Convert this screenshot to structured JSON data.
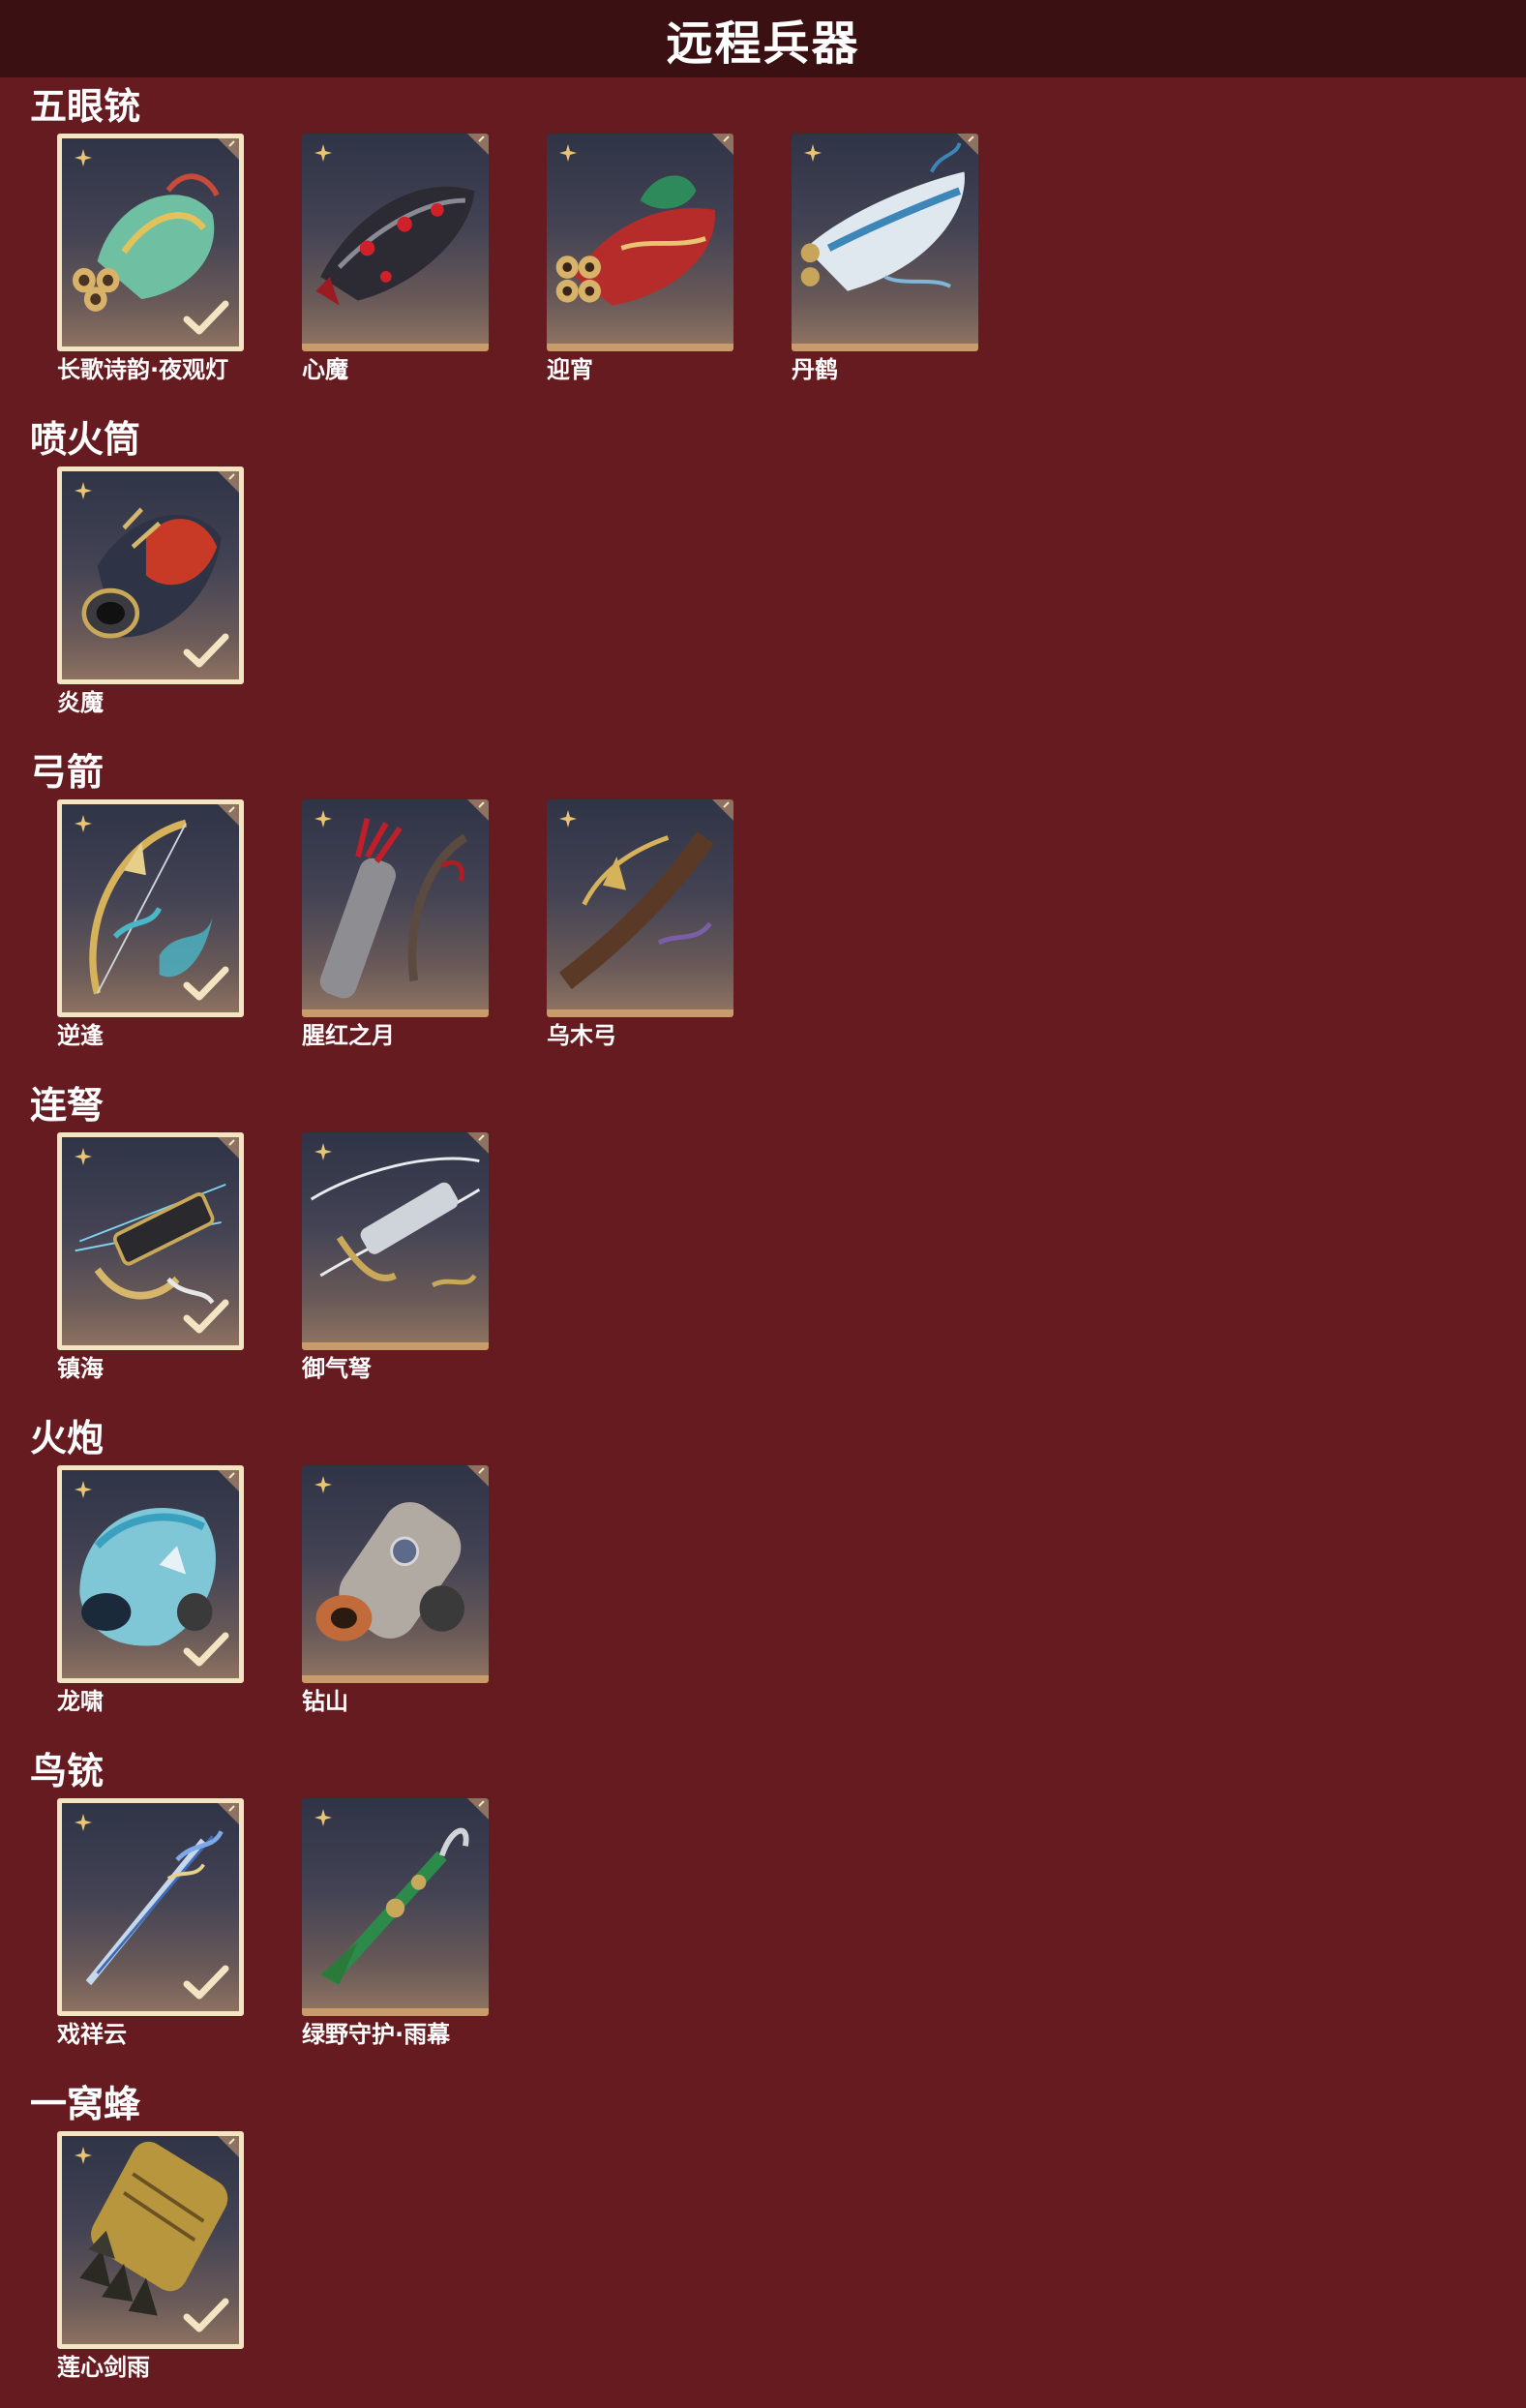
{
  "page": {
    "title": "远程兵器"
  },
  "colors": {
    "background": "#651b1f",
    "header": "#3b1012",
    "equipped_border": "#f3e4c2",
    "card_bottom": "#c99b6a",
    "star": "#e8c474"
  },
  "sections": [
    {
      "title": "五眼铳",
      "items": [
        {
          "name": "长歌诗韵·夜观灯",
          "equipped": true,
          "icon": "five-barrel-gun-jade-icon"
        },
        {
          "name": "心魔",
          "equipped": false,
          "icon": "five-barrel-gun-demon-icon"
        },
        {
          "name": "迎宵",
          "equipped": false,
          "icon": "five-barrel-gun-red-icon"
        },
        {
          "name": "丹鹤",
          "equipped": false,
          "icon": "five-barrel-gun-crane-icon"
        }
      ]
    },
    {
      "title": "喷火筒",
      "items": [
        {
          "name": "炎魔",
          "equipped": true,
          "icon": "flamethrower-icon"
        }
      ]
    },
    {
      "title": "弓箭",
      "items": [
        {
          "name": "逆逢",
          "equipped": true,
          "icon": "bow-gold-icon"
        },
        {
          "name": "腥红之月",
          "equipped": false,
          "icon": "bow-crimson-icon"
        },
        {
          "name": "乌木弓",
          "equipped": false,
          "icon": "bow-ebony-icon"
        }
      ]
    },
    {
      "title": "连弩",
      "items": [
        {
          "name": "镇海",
          "equipped": true,
          "icon": "repeating-crossbow-icon"
        },
        {
          "name": "御气弩",
          "equipped": false,
          "icon": "crossbow-silver-icon"
        }
      ]
    },
    {
      "title": "火炮",
      "items": [
        {
          "name": "龙啸",
          "equipped": true,
          "icon": "dragon-cannon-icon"
        },
        {
          "name": "钻山",
          "equipped": false,
          "icon": "cannon-icon"
        }
      ]
    },
    {
      "title": "鸟铳",
      "items": [
        {
          "name": "戏祥云",
          "equipped": true,
          "icon": "musket-blue-icon"
        },
        {
          "name": "绿野守护·雨幕",
          "equipped": false,
          "icon": "musket-green-icon"
        }
      ]
    },
    {
      "title": "一窝蜂",
      "items": [
        {
          "name": "莲心剑雨",
          "equipped": true,
          "icon": "rocket-launcher-icon"
        }
      ]
    }
  ]
}
